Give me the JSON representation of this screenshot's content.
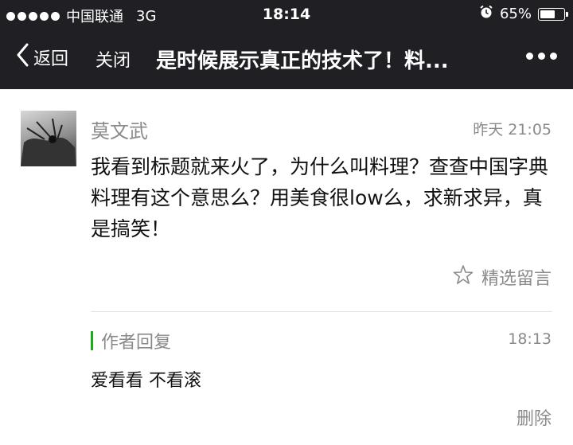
{
  "status_bar": {
    "carrier": "中国联通",
    "network": "3G",
    "time": "18:14",
    "battery": "65%",
    "battery_level": 0.65,
    "signal_bars": 5
  },
  "nav": {
    "back_label": "返回",
    "close_label": "关闭",
    "title": "是时候展示真正的技术了！料..."
  },
  "comment": {
    "nickname": "莫文武",
    "time": "昨天 21:05",
    "text": "我看到标题就来火了，为什么叫料理？查查中国字典料理有这个意思么？用美食很low么，求新求异，真是搞笑！",
    "select_label": "精选留言"
  },
  "reply": {
    "label": "作者回复",
    "time": "18:13",
    "text": "爱看看 不看滚",
    "delete_label": "删除"
  },
  "colors": {
    "bar_bg": "#1f1f24",
    "accent_green": "#1aad19",
    "meta_gray": "#8a8a8a"
  }
}
